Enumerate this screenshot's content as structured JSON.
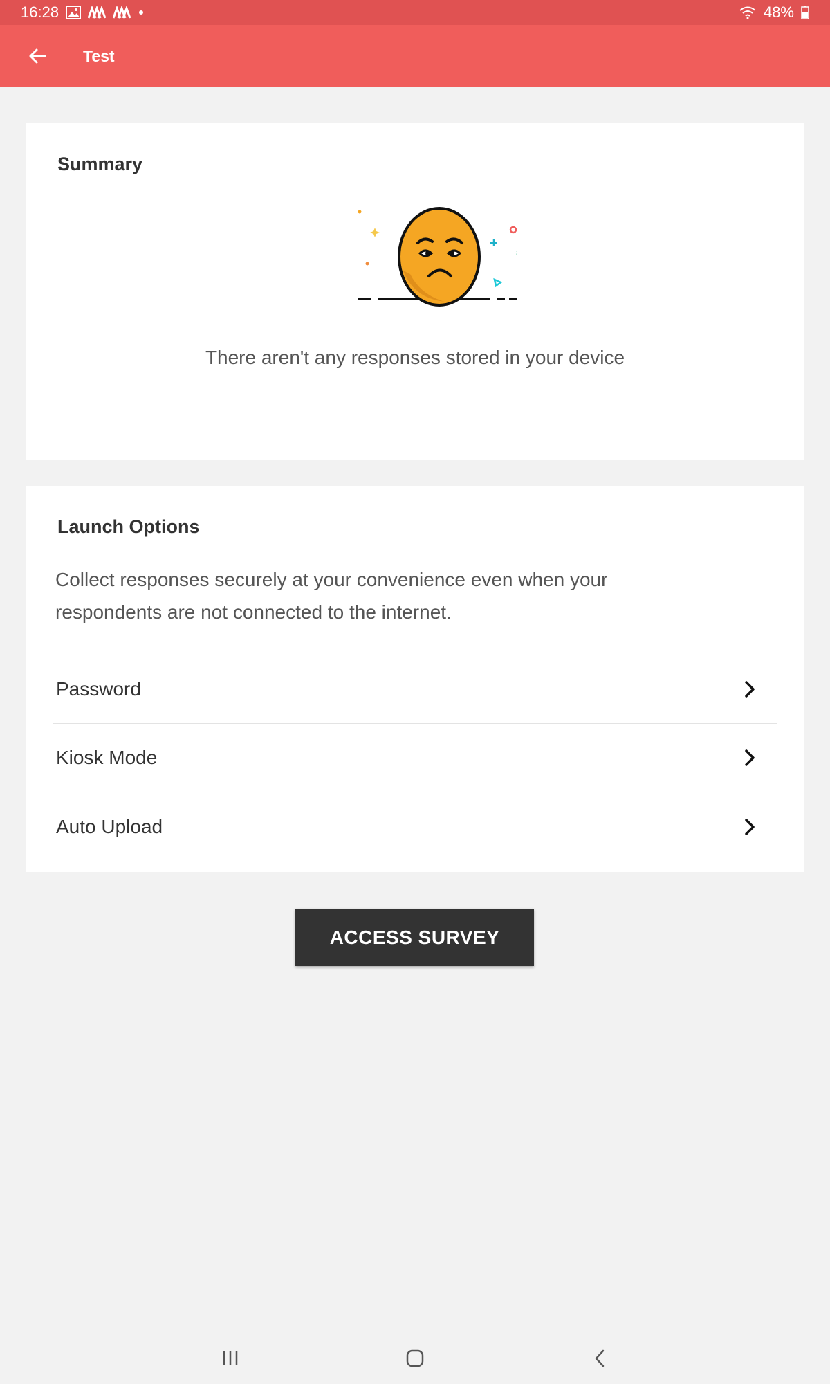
{
  "status_bar": {
    "time": "16:28",
    "battery": "48%",
    "icons_left": [
      "gallery-icon",
      "app-icon",
      "app-icon",
      "dot-icon"
    ],
    "icons_right": [
      "wifi-icon",
      "battery-icon"
    ]
  },
  "app_bar": {
    "title": "Test",
    "background": "#f05d5b",
    "back_icon": "arrow-left-icon"
  },
  "summary": {
    "heading": "Summary",
    "illustration": "sad-face-icon",
    "empty_message": "There aren't any responses stored in your device"
  },
  "launch_options": {
    "heading": "Launch Options",
    "description": "Collect responses securely at your convenience even when your respondents are not connected to the internet.",
    "items": [
      {
        "label": "Password",
        "icon": "chevron-right-icon"
      },
      {
        "label": "Kiosk Mode",
        "icon": "chevron-right-icon"
      },
      {
        "label": "Auto Upload",
        "icon": "chevron-right-icon"
      }
    ]
  },
  "primary_action": {
    "label": "ACCESS SURVEY",
    "background": "#333333"
  },
  "nav_bar": {
    "buttons": [
      "recents-icon",
      "home-icon",
      "back-icon"
    ]
  }
}
